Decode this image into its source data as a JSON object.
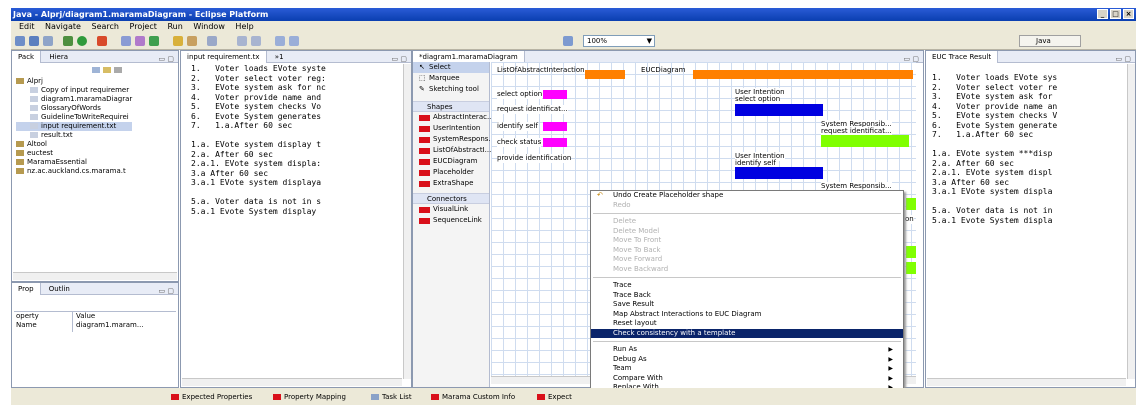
{
  "window": {
    "title": "Java - Alprj/diagram1.maramaDiagram - Eclipse Platform",
    "controls": [
      "_",
      "□",
      "×"
    ]
  },
  "menu": [
    "Edit",
    "Navigate",
    "Search",
    "Project",
    "Run",
    "Window",
    "Help"
  ],
  "toolbar": {
    "zoom": "100%",
    "perspective": "Java"
  },
  "package_view": {
    "tabs": [
      "Pack",
      "Hiera"
    ],
    "tree": [
      {
        "label": "Alprj",
        "indent": 0
      },
      {
        "label": "Copy of input requiremer",
        "indent": 1
      },
      {
        "label": "diagram1.maramaDiagrar",
        "indent": 1
      },
      {
        "label": "GlossaryOfWords",
        "indent": 1
      },
      {
        "label": "GuidelineToWriteRequirei",
        "indent": 1
      },
      {
        "label": "input requirement.txt",
        "indent": 1,
        "selected": true
      },
      {
        "label": "result.txt",
        "indent": 1
      },
      {
        "label": "Altool",
        "indent": 0
      },
      {
        "label": "euctest",
        "indent": 0
      },
      {
        "label": "MaramaEssential",
        "indent": 0
      },
      {
        "label": "nz.ac.auckland.cs.marama.t",
        "indent": 0
      }
    ]
  },
  "properties_view": {
    "tabs": [
      "Prop",
      "Outlin"
    ],
    "headers": [
      "operty",
      "Value"
    ],
    "rows": [
      [
        "Name",
        "diagram1.maram..."
      ]
    ]
  },
  "editor": {
    "tabs": [
      "input requirement.tx",
      "»1"
    ],
    "lines": [
      "1.   Voter loads EVote syste",
      "2.   Voter select voter reg:",
      "3.   EVote system ask for nc",
      "4.   Voter provide name and",
      "5.   EVote system checks Vo",
      "6.   Evote System generates",
      "7.   1.a.After 60 sec",
      "",
      "1.a. EVote system display t",
      "2.a. After 60 sec",
      "2.a.1. EVote system displa:",
      "3.a After 60 sec",
      "3.a.1 EVote system displaya",
      "",
      "5.a. Voter data is not in s",
      "5.a.1 Evote System display"
    ]
  },
  "diagram": {
    "tab": "*diagram1.maramaDiagram",
    "palette": {
      "tools": [
        "Select",
        "Marquee",
        "Sketching tool"
      ],
      "shapes_header": "Shapes",
      "shapes": [
        "AbstractInterac...",
        "UserIntention",
        "SystemRespons...",
        "ListOfAbstractI...",
        "EUCDiagram",
        "Placeholder",
        "ExtraShape"
      ],
      "connectors_header": "Connectors",
      "connectors": [
        "VisualLink",
        "SequenceLink"
      ]
    },
    "shapes": {
      "list_label": "ListOfAbstractInteraction",
      "euc_label": "EUCDiagram",
      "items": [
        "select option",
        "request identificat...",
        "identify self",
        "check status",
        "provide identification"
      ],
      "ui1": "User Intention",
      "ui1_sub": "select option",
      "sr1": "System Responsib...",
      "sr1_sub": "request identificat...",
      "ui2": "User Intention",
      "ui2_sub": "identify self",
      "sr2": "System Responsib...",
      "partial": "on"
    },
    "colors": {
      "orange": "#ff8000",
      "magenta": "#ff00ff",
      "blue": "#0000e0",
      "green": "#80ff00"
    }
  },
  "context_menu": {
    "items": [
      {
        "label": "Undo Create Placeholder shape",
        "state": "normal",
        "icon": true
      },
      {
        "label": "Redo",
        "state": "disabled"
      },
      {
        "sep": true
      },
      {
        "label": "Delete",
        "state": "disabled"
      },
      {
        "label": "Delete Model",
        "state": "disabled"
      },
      {
        "label": "Move To Front",
        "state": "disabled"
      },
      {
        "label": "Move To Back",
        "state": "disabled"
      },
      {
        "label": "Move Forward",
        "state": "disabled"
      },
      {
        "label": "Move Backward",
        "state": "disabled"
      },
      {
        "sep": true
      },
      {
        "label": "Trace",
        "state": "normal"
      },
      {
        "label": "Trace Back",
        "state": "normal"
      },
      {
        "label": "Save Result",
        "state": "normal"
      },
      {
        "label": "Map Abstract Interactions to EUC Diagram",
        "state": "normal"
      },
      {
        "label": "Reset layout",
        "state": "normal"
      },
      {
        "label": "Check consistency with a template",
        "state": "selected"
      },
      {
        "sep": true
      },
      {
        "label": "Run As",
        "state": "normal",
        "submenu": true
      },
      {
        "label": "Debug As",
        "state": "normal",
        "submenu": true
      },
      {
        "label": "Team",
        "state": "normal",
        "submenu": true
      },
      {
        "label": "Compare With",
        "state": "normal",
        "submenu": true
      },
      {
        "label": "Replace With",
        "state": "normal",
        "submenu": true
      }
    ]
  },
  "trace_view": {
    "tab": "EUC Trace Result",
    "lines": [
      "1.   Voter loads EVote sys",
      "2.   Voter select voter re",
      "3.   EVote system ask for",
      "4.   Voter provide name an",
      "5.   EVote system checks V",
      "6.   Evote System generate",
      "7.   1.a.After 60 sec",
      "",
      "1.a. EVote system ***disp",
      "2.a. After 60 sec",
      "2.a.1. EVote system displ",
      "3.a After 60 sec",
      "3.a.1 EVote system displa",
      "",
      "5.a. Voter data is not in",
      "5.a.1 Evote System displa"
    ]
  },
  "bottom_tabs": [
    "Expected Properties",
    "Property Mapping",
    "Task List",
    "Marama Custom Info",
    "Expect"
  ]
}
